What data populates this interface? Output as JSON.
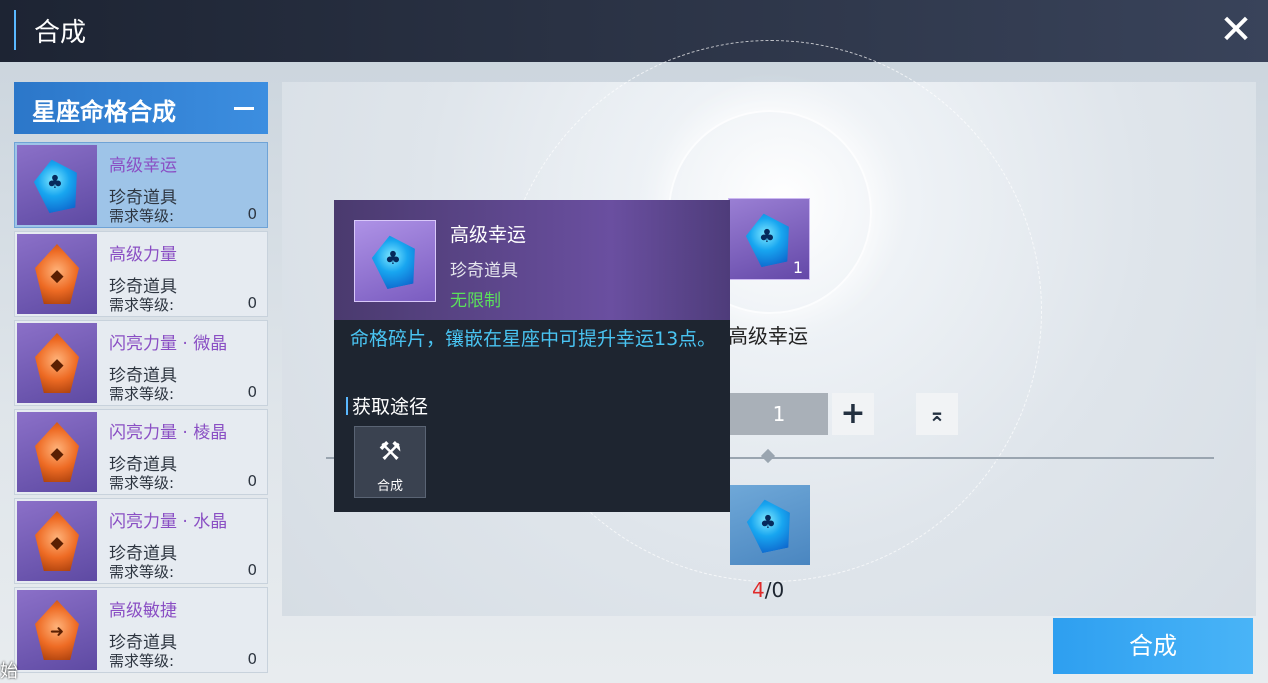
{
  "header": {
    "title": "合成",
    "close_icon": "close-icon"
  },
  "sidebar": {
    "category": "星座命格合成",
    "items": [
      {
        "name": "高级幸运",
        "type": "珍奇道具",
        "req_label": "需求等级:",
        "req_value": "0",
        "gem": "blue",
        "selected": true
      },
      {
        "name": "高级力量",
        "type": "珍奇道具",
        "req_label": "需求等级:",
        "req_value": "0",
        "gem": "orange"
      },
      {
        "name": "闪亮力量 · 微晶",
        "type": "珍奇道具",
        "req_label": "需求等级:",
        "req_value": "0",
        "gem": "orange"
      },
      {
        "name": "闪亮力量 · 棱晶",
        "type": "珍奇道具",
        "req_label": "需求等级:",
        "req_value": "0",
        "gem": "orange"
      },
      {
        "name": "闪亮力量 · 水晶",
        "type": "珍奇道具",
        "req_label": "需求等级:",
        "req_value": "0",
        "gem": "orange"
      },
      {
        "name": "高级敏捷",
        "type": "珍奇道具",
        "req_label": "需求等级:",
        "req_value": "0",
        "gem": "orange"
      }
    ]
  },
  "main": {
    "target": {
      "name": "高级幸运",
      "count": "1"
    },
    "quantity": "1",
    "material": {
      "have": "4",
      "need": "0"
    },
    "compose_label": "合成"
  },
  "tooltip": {
    "name": "高级幸运",
    "type": "珍奇道具",
    "limit": "无限制",
    "description": "命格碎片，镶嵌在星座中可提升幸运13点。",
    "source_title": "获取途径",
    "source_label": "合成"
  },
  "corner_text": "始"
}
